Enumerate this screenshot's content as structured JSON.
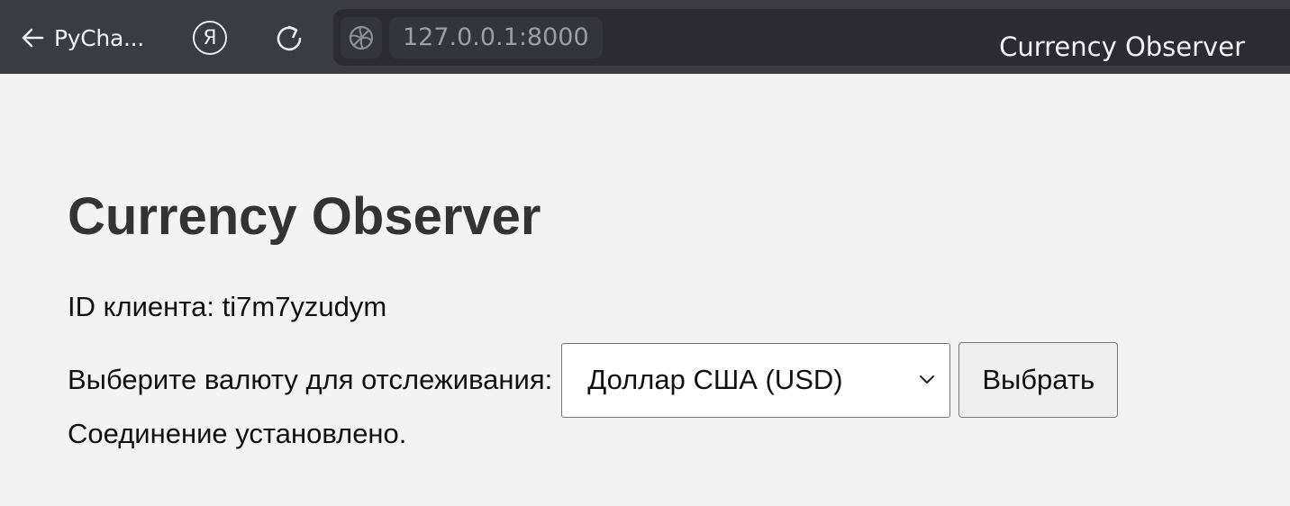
{
  "browser": {
    "back_label": "PyCha...",
    "yandex_glyph": "Я",
    "url": "127.0.0.1:8000",
    "tab_title": "Currency Observer",
    "icons": [
      "arrow-left-icon",
      "yandex-icon",
      "reload-icon",
      "globe-icon"
    ]
  },
  "page": {
    "heading": "Currency Observer",
    "client_label": "ID клиента:",
    "client_id": "ti7m7yzudym",
    "select_label": "Выберите валюту для отслеживания:",
    "selected_currency": "Доллар США (USD)",
    "select_button": "Выбрать",
    "status": "Соединение установлено."
  },
  "colors": {
    "topbar": "#3b3b43",
    "addressbar": "#2b2b31",
    "page_background": "#f3f3f3",
    "heading": "#333333"
  }
}
